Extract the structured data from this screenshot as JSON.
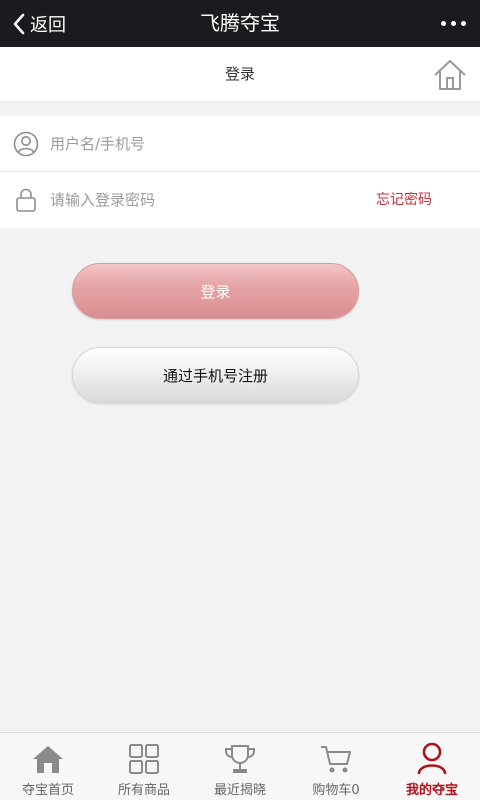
{
  "topbar": {
    "back_label": "返回",
    "title": "飞腾夺宝"
  },
  "subheader": {
    "title": "登录"
  },
  "form": {
    "username_placeholder": "用户名/手机号",
    "password_placeholder": "请输入登录密码",
    "forgot_label": "忘记密码"
  },
  "buttons": {
    "login_label": "登录",
    "register_label": "通过手机号注册"
  },
  "bottom_nav": {
    "items": [
      {
        "label": "夺宝首页",
        "icon": "home-icon"
      },
      {
        "label": "所有商品",
        "icon": "grid-icon"
      },
      {
        "label": "最近揭晓",
        "icon": "trophy-icon"
      },
      {
        "label": "购物车0",
        "icon": "cart-icon"
      },
      {
        "label": "我的夺宝",
        "icon": "user-icon"
      }
    ],
    "active_index": 4
  },
  "colors": {
    "topbar": "#1b1b1f",
    "accent": "#b0131e",
    "forgot": "#c8313b"
  }
}
